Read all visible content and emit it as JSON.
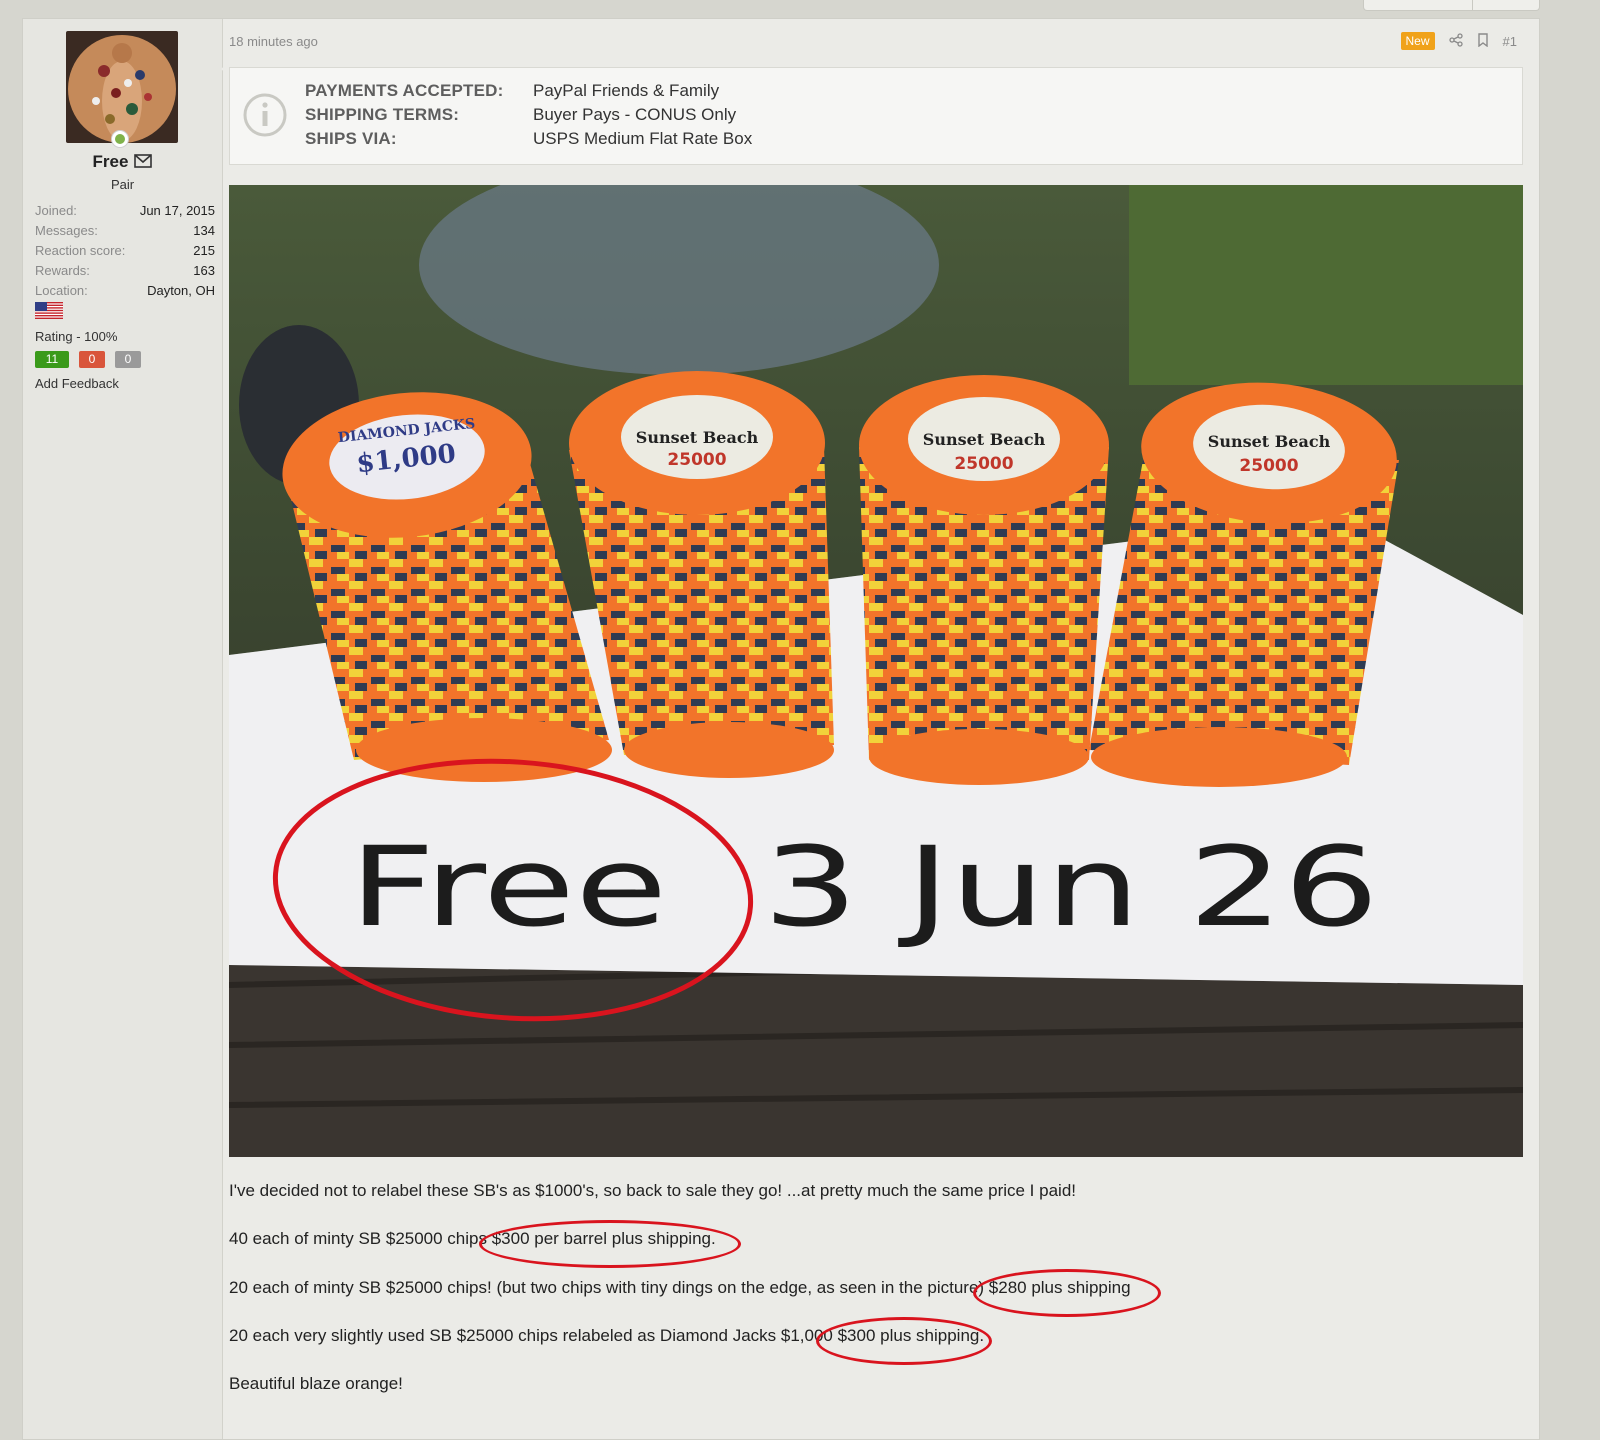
{
  "post": {
    "time_ago": "18 minutes ago",
    "new_badge": "New",
    "post_number": "#1"
  },
  "user": {
    "name": "Free",
    "title": "Pair",
    "stats": [
      {
        "label": "Joined:",
        "value": "Jun 17, 2015"
      },
      {
        "label": "Messages:",
        "value": "134"
      },
      {
        "label": "Reaction score:",
        "value": "215"
      },
      {
        "label": "Rewards:",
        "value": "163"
      },
      {
        "label": "Location:",
        "value": "Dayton, OH"
      }
    ],
    "rating_label": "Rating - 100%",
    "feedback": {
      "positive": "11",
      "negative": "0",
      "neutral": "0"
    },
    "add_feedback": "Add Feedback"
  },
  "sale_info": {
    "payments_label": "PAYMENTS ACCEPTED:",
    "payments_value": "PayPal Friends & Family",
    "shipping_label": "SHIPPING TERMS:",
    "shipping_value": "Buyer Pays - CONUS Only",
    "ships_via_label": "SHIPS VIA:",
    "ships_via_value": "USPS Medium Flat Rate Box"
  },
  "photo": {
    "chip_labels": [
      "$1,000",
      "25000",
      "25000",
      "25000"
    ],
    "chip_brands": [
      "DIAMOND JACKS",
      "Sunset Beach",
      "Sunset Beach",
      "Sunset Beach"
    ],
    "handwritten": "Free  3 Jun 26"
  },
  "body": {
    "line1": "I've decided not to relabel these SB's as $1000's, so back to sale they go! ...at pretty much the same price I paid!",
    "line2": "40 each of minty SB $25000 chips $300 per barrel plus shipping.",
    "line3": "20 each of minty SB $25000 chips! (but two chips with tiny dings on the edge, as seen in the picture) $280 plus shipping",
    "line4": "20 each very slightly used SB $25000 chips relabeled as Diamond Jacks $1,000 $300 plus shipping.",
    "line5": "Beautiful blaze orange!"
  },
  "colors": {
    "accent_new": "#f0a21a",
    "feedback_positive": "#3a9a1a",
    "feedback_negative": "#d9553b",
    "feedback_neutral": "#9a9a9a",
    "annotation_red": "#d9141e"
  }
}
